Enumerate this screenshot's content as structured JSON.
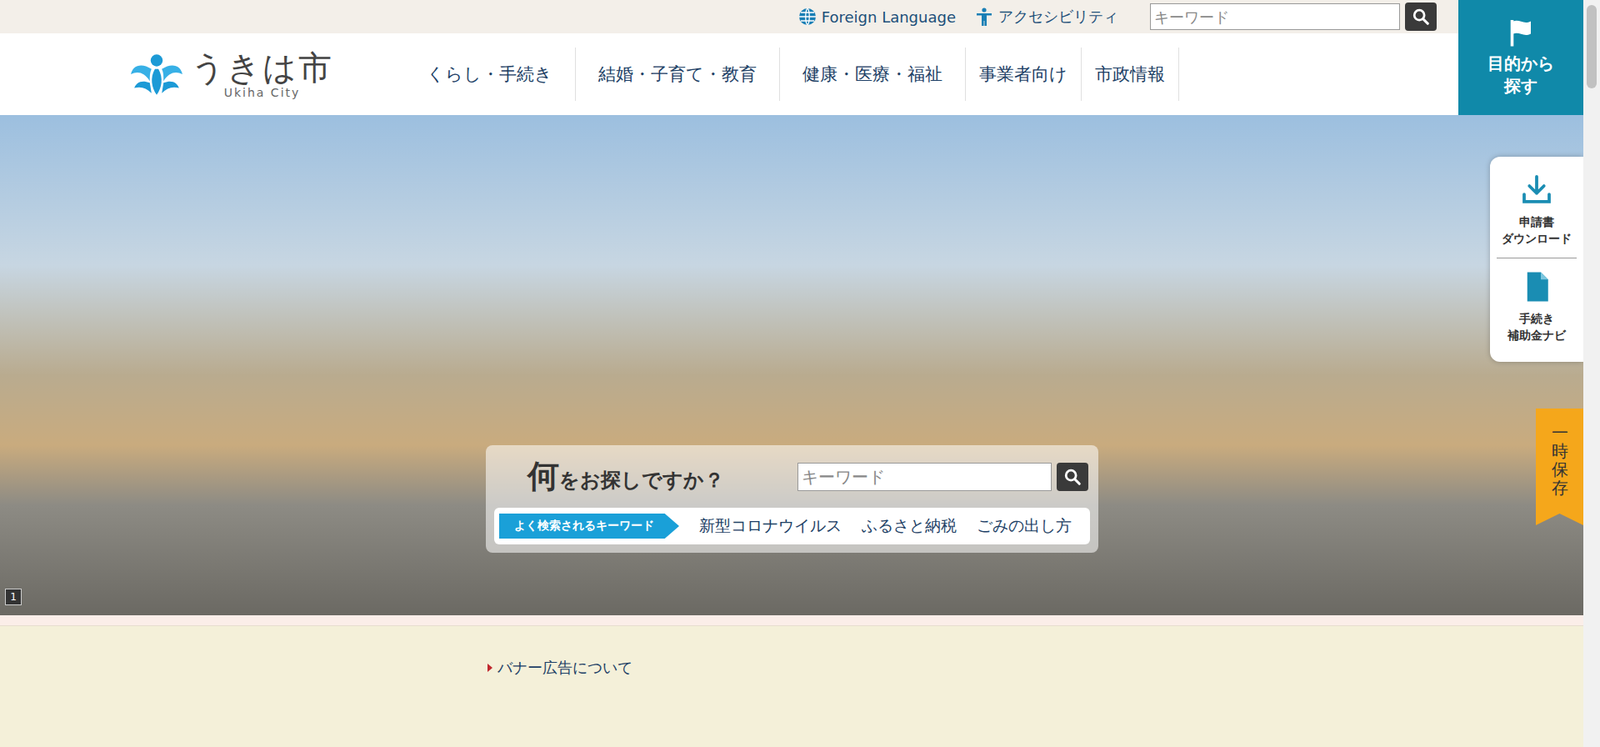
{
  "top_bar": {
    "links": [
      {
        "label": "Foreign Language",
        "kind": "globe"
      },
      {
        "label": "アクセシビリティ",
        "kind": "person"
      }
    ],
    "search": {
      "placeholder": "キーワード"
    }
  },
  "purpose_button": {
    "lines": [
      "目的から",
      "探す"
    ]
  },
  "logo": {
    "name": "うきは市",
    "romaji": "Ukiha City"
  },
  "nav": {
    "items": [
      "くらし・手続き",
      "結婚・子育て・教育",
      "健康・医療・福祉",
      "事業者向け",
      "市政情報"
    ]
  },
  "hero": {
    "slide_counter": "1",
    "search": {
      "title": "何をお探しですか？",
      "placeholder": "キーワード",
      "popular_label": "よく検索されるキーワード",
      "keywords": [
        "新型コロナウイルス",
        "ふるさと納税",
        "ごみの出し方"
      ]
    }
  },
  "side_panel": {
    "items": [
      {
        "lines": [
          "申請書",
          "ダウンロード"
        ],
        "kind": "download"
      },
      {
        "lines": [
          "手続き",
          "補助金ナビ"
        ],
        "kind": "document"
      }
    ]
  },
  "save_tab": {
    "label": "一時保存"
  },
  "banner": {
    "link": "バナー広告について"
  }
}
